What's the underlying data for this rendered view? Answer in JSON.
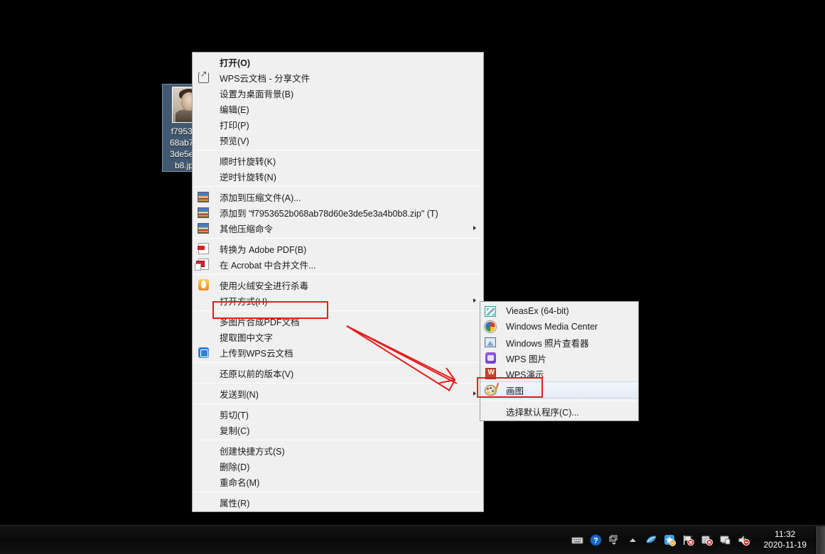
{
  "desktop": {
    "icon": {
      "name": "f795365268ab78d60e3de5e3a4b0b8.jp",
      "label_lines": [
        "f79536",
        "68ab78",
        "3de5e3",
        "b8.jp"
      ],
      "thumbnail_alt": "photo-thumbnail"
    },
    "background_color": "#000000"
  },
  "context_menu": {
    "items": [
      {
        "label": "打开(O)",
        "icon": "",
        "bold": true,
        "submenu": false
      },
      {
        "label": "WPS云文档 - 分享文件",
        "icon": "share-icon",
        "bold": false,
        "submenu": false
      },
      {
        "label": "设置为桌面背景(B)",
        "icon": "",
        "bold": false,
        "submenu": false
      },
      {
        "label": "编辑(E)",
        "icon": "",
        "bold": false,
        "submenu": false
      },
      {
        "label": "打印(P)",
        "icon": "",
        "bold": false,
        "submenu": false
      },
      {
        "label": "预览(V)",
        "icon": "",
        "bold": false,
        "submenu": false
      },
      {
        "separator": true
      },
      {
        "label": "顺时针旋转(K)",
        "icon": "",
        "bold": false,
        "submenu": false
      },
      {
        "label": "逆时针旋转(N)",
        "icon": "",
        "bold": false,
        "submenu": false
      },
      {
        "separator": true
      },
      {
        "label": "添加到压缩文件(A)...",
        "icon": "winrar-icon",
        "bold": false,
        "submenu": false
      },
      {
        "label": "添加到 \"f7953652b068ab78d60e3de5e3a4b0b8.zip\" (T)",
        "icon": "winrar-icon",
        "bold": false,
        "submenu": false
      },
      {
        "label": "其他压缩命令",
        "icon": "winrar-icon",
        "bold": false,
        "submenu": true
      },
      {
        "separator": true
      },
      {
        "label": "转换为 Adobe PDF(B)",
        "icon": "adobe-pdf-icon",
        "bold": false,
        "submenu": false
      },
      {
        "label": "在 Acrobat 中合并文件...",
        "icon": "adobe-combine-icon",
        "bold": false,
        "submenu": false
      },
      {
        "separator": true
      },
      {
        "label": "使用火绒安全进行杀毒",
        "icon": "huorong-icon",
        "bold": false,
        "submenu": false
      },
      {
        "label": "打开方式(H)",
        "icon": "",
        "bold": false,
        "submenu": true,
        "highlighted": true
      },
      {
        "separator": true
      },
      {
        "label": "多图片合成PDF文档",
        "icon": "",
        "bold": false,
        "submenu": false
      },
      {
        "label": "提取图中文字",
        "icon": "",
        "bold": false,
        "submenu": false
      },
      {
        "label": "上传到WPS云文档",
        "icon": "wps-cloud-icon",
        "bold": false,
        "submenu": false
      },
      {
        "separator": true
      },
      {
        "label": "还原以前的版本(V)",
        "icon": "",
        "bold": false,
        "submenu": false
      },
      {
        "separator": true
      },
      {
        "label": "发送到(N)",
        "icon": "",
        "bold": false,
        "submenu": true
      },
      {
        "separator": true
      },
      {
        "label": "剪切(T)",
        "icon": "",
        "bold": false,
        "submenu": false
      },
      {
        "label": "复制(C)",
        "icon": "",
        "bold": false,
        "submenu": false
      },
      {
        "separator": true
      },
      {
        "label": "创建快捷方式(S)",
        "icon": "",
        "bold": false,
        "submenu": false
      },
      {
        "label": "删除(D)",
        "icon": "",
        "bold": false,
        "submenu": false
      },
      {
        "label": "重命名(M)",
        "icon": "",
        "bold": false,
        "submenu": false
      },
      {
        "separator": true
      },
      {
        "label": "属性(R)",
        "icon": "",
        "bold": false,
        "submenu": false
      }
    ]
  },
  "open_with_submenu": {
    "items": [
      {
        "label": "VieasEx (64-bit)",
        "icon": "vieas-icon",
        "hover": false
      },
      {
        "label": "Windows Media Center",
        "icon": "windows-media-center-icon",
        "hover": false
      },
      {
        "label": "Windows 照片查看器",
        "icon": "windows-photo-viewer-icon",
        "hover": false
      },
      {
        "label": "WPS 图片",
        "icon": "wps-picture-icon",
        "hover": false
      },
      {
        "label": "WPS演示",
        "icon": "wps-presentation-icon",
        "hover": false
      },
      {
        "label": "画图",
        "icon": "paint-icon",
        "hover": true
      },
      {
        "separator": true
      },
      {
        "label": "选择默认程序(C)...",
        "icon": "",
        "hover": false
      }
    ]
  },
  "annotations": {
    "highlight_color": "#e32020",
    "boxes": [
      {
        "target": "打开方式(H)"
      },
      {
        "target": "画图"
      }
    ],
    "arrow": {
      "from": "打开方式(H)",
      "to": "画图"
    }
  },
  "taskbar": {
    "tray_icons": [
      "keyboard-icon",
      "help-icon",
      "window-switch-icon",
      "show-hidden-icons-icon",
      "kingsoft-icon",
      "security-center-icon",
      "flag-error-icon",
      "network-error-icon",
      "display-icon",
      "volume-muted-icon"
    ],
    "clock": {
      "time": "11:32",
      "date": "2020-11-19"
    },
    "show_desktop_button": "show-desktop-button"
  }
}
